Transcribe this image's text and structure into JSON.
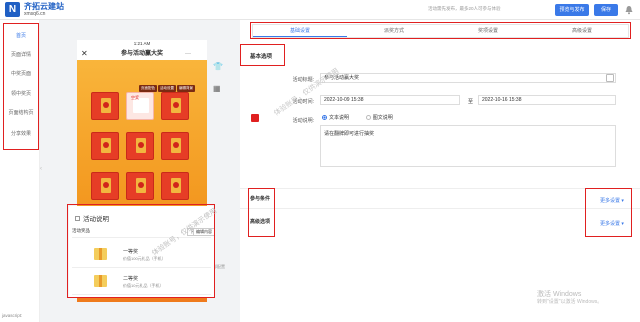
{
  "header": {
    "logo_char": "N",
    "brand": "齐拓云建站",
    "domain": "xmsq6.cn",
    "notice": "活动需先发布，最多20人可参与体验",
    "preview_label": "预览与发布",
    "save_label": "保存"
  },
  "sidebar": {
    "items": [
      {
        "label": "首页"
      },
      {
        "label": "页面详情"
      },
      {
        "label": "中奖页面"
      },
      {
        "label": "领中奖页"
      },
      {
        "label": "页面结构页"
      },
      {
        "label": "分享效果"
      }
    ],
    "footer": "javascript:"
  },
  "phone": {
    "status_time": "1:21 AM",
    "title": "参与活动赢大奖",
    "mini_buttons": [
      "页面配色",
      "活动设置",
      "编辑背景"
    ],
    "center_text": "空奖"
  },
  "description": {
    "title": "活动说明",
    "prize_header": "活动奖品",
    "prize_btns": [
      "下移",
      "编辑内容"
    ],
    "prizes": [
      {
        "name": "一等奖",
        "sub": "价值100元礼品（手机）"
      },
      {
        "name": "二等奖",
        "sub": "价值10元礼品（手机）"
      }
    ]
  },
  "right_side_label": "顶部配置",
  "tabs": [
    "基础设置",
    "派奖方式",
    "奖项设置",
    "高级设置"
  ],
  "form": {
    "section": "基本选项",
    "name_label": "活动标题:",
    "name_value": "参与活动赢大奖",
    "time_label": "活动时间:",
    "start": "2022-10-09 15:38",
    "to": "至",
    "end": "2022-10-16 15:38",
    "desc_label": "活动说明:",
    "radio_text": "文本说明",
    "radio_image": "图文说明",
    "desc_value": "请在翻牌即可进行抽奖"
  },
  "conditions": {
    "title": "参与条件",
    "more": "更多设置"
  },
  "advanced": {
    "title": "高级选项",
    "more": "更多设置"
  },
  "watermark": "体验账号，仅供演示使用",
  "windows": {
    "line1": "激活 Windows",
    "line2": "转到\"设置\"以激活 Windows。"
  }
}
